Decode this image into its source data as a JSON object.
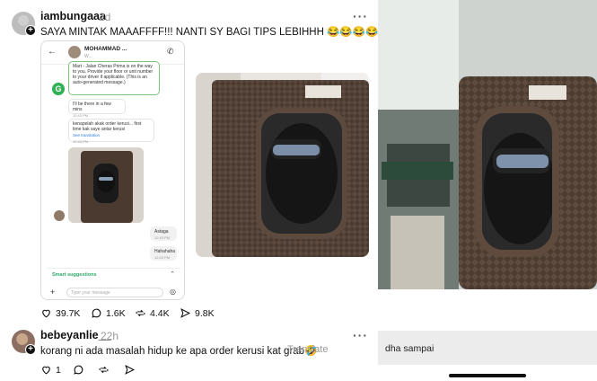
{
  "post": {
    "username": "iambungaaa",
    "time": "2d",
    "more": "···",
    "text": "SAYA MINTAK MAAAFFFF!!! NANTI SY BAGI TIPS LEBIHHH 😂😂😂😂",
    "likes": "39.7K",
    "replies": "1.6K",
    "reposts": "4.4K",
    "shares": "9.8K"
  },
  "chat": {
    "contact_name": "MOHAMMAD ...",
    "contact_sub": "W...",
    "system_message": "Mart - Jalan Cheras Prima is on the way to you. Provide your floor or unit number to your driver if applicable. (This is an auto-generated message.)",
    "msg1": "I'll be there in a few mins",
    "msg1_time": "12:43 PM",
    "msg2": "kenapelah akak order kerusi... first time kak saye antar kerusi",
    "msg2_link": "See translation",
    "msg2_time": "12:43 PM",
    "msg3": "Astaga",
    "msg3_time": "12:43 PM",
    "msg4": "Hahahaha",
    "msg4_time": "12:43 PM",
    "smart_suggestions": "Smart suggestions",
    "input_placeholder": "Type your message"
  },
  "reply": {
    "username": "bebeyanlie__",
    "time": "22h",
    "more": "···",
    "text": "korang ni ada masalah hidup ke apa order kerusi kat grab🤣",
    "translate": "Translate",
    "likes": "1"
  },
  "right_panel": {
    "comment": "dha sampai"
  },
  "colors": {
    "chair_brown": "#4a3a30",
    "accent_green": "#2fb052"
  }
}
